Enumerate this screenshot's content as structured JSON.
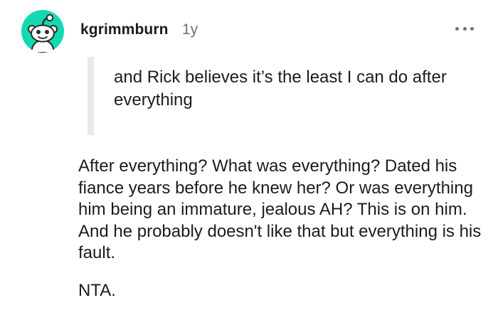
{
  "comment": {
    "username": "kgrimmburn",
    "age": "1y",
    "avatar_icon": "snoo-avatar-icon",
    "avatar_color": "#14d9b0",
    "more_icon": "more-options-icon",
    "quote": "and Rick believes it’s the least I can do after everything",
    "body_paragraphs": [
      "After everything? What was everything? Dated his fiance years before he knew her? Or was everything him being an immature, jealous AH? This is on him. And he probably doesn't like that but everything is his fault.",
      "NTA."
    ]
  }
}
